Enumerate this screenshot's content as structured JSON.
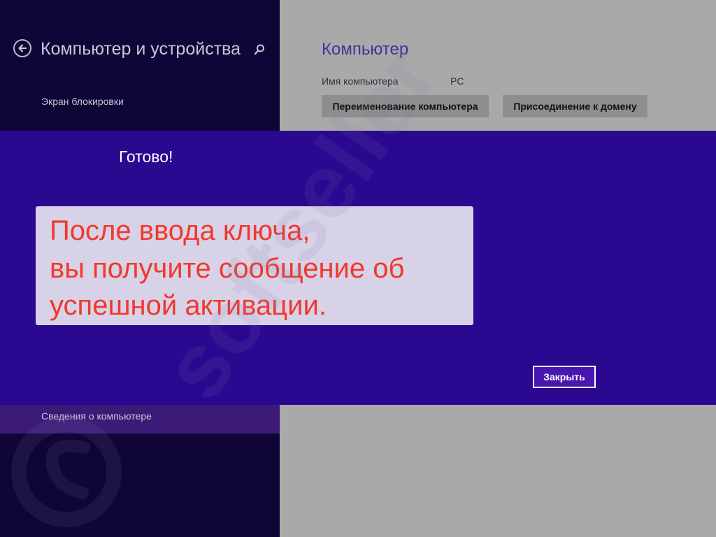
{
  "sidebar": {
    "title": "Компьютер и устройства",
    "items": [
      {
        "label": "Экран блокировки"
      },
      {
        "label": "Сведения о компьютере"
      }
    ],
    "back_icon": "arrow-left-circle-icon",
    "search_icon": "search-icon"
  },
  "main": {
    "section_title": "Компьютер",
    "computer_name_label": "Имя компьютера",
    "computer_name_value": "PC",
    "rename_button": "Переименование компьютера",
    "join_domain_button": "Присоединение к домену"
  },
  "dialog": {
    "title": "Готово!",
    "close_button": "Закрыть"
  },
  "callout": {
    "lines": [
      "После ввода ключа,",
      "вы получите сообщение об",
      "успешной активации."
    ]
  },
  "watermark": {
    "text": "softseller"
  },
  "colors": {
    "left_pane": "#0f0537",
    "dialog": "#2a0890",
    "accent_text": "#4a2e9a",
    "callout_text": "#f0392b"
  }
}
